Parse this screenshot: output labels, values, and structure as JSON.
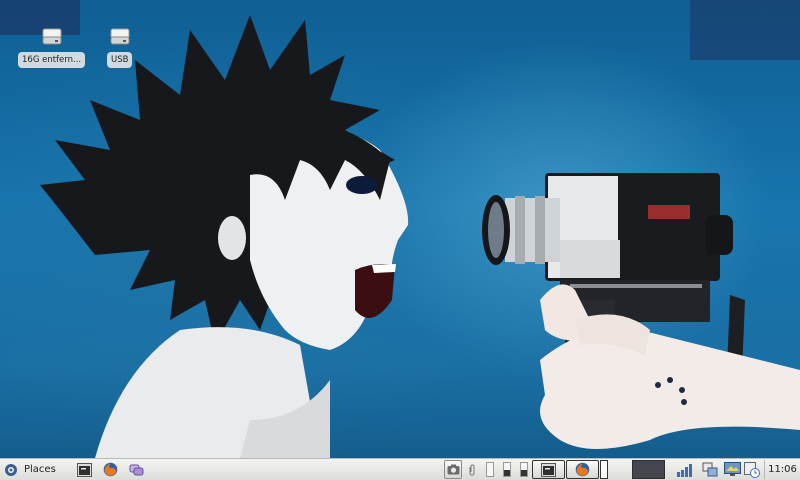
{
  "desktop": {
    "icons": [
      {
        "label": "16G entfern...",
        "icon": "drive-icon"
      },
      {
        "label": "USB",
        "icon": "drive-icon"
      }
    ]
  },
  "panel": {
    "main_menu_icon": "distro-logo-icon",
    "places_label": "Places",
    "launchers": [
      "terminal-icon",
      "firefox-icon",
      "chat-icon"
    ],
    "tray": [
      "screenshot-icon",
      "paperclip-icon"
    ],
    "workspaces": 4,
    "tasks": [
      "terminal-task-icon",
      "firefox-task-icon"
    ],
    "status_icons": [
      "signal-strength-icon",
      "network-icon",
      "display-icon",
      "clock-settings-icon"
    ],
    "clock": "11:06"
  },
  "colors": {
    "wallpaper_blue": "#1775ad",
    "panel_bg": "#e8e8e5"
  }
}
